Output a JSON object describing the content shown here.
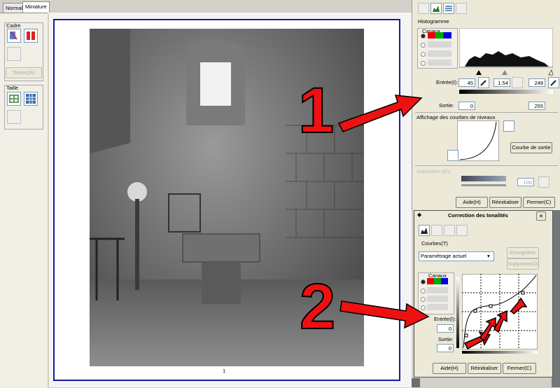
{
  "tabs": [
    {
      "label": "Normal"
    },
    {
      "label": "Miniature"
    }
  ],
  "left_panel": {
    "cadre_title": "Cadre",
    "toutes_label": "Toutes(A)",
    "taille_title": "Taille"
  },
  "preview": {
    "page_number": "1"
  },
  "histogram_panel": {
    "title": "Histogramme",
    "canaux_label": "Canaux",
    "entree_label": "Entrée(I):",
    "entree_black": "45",
    "entree_gamma": "1.54",
    "entree_white": "248",
    "sortie_label": "Sortie:",
    "sortie_black": "0",
    "sortie_white": "255",
    "curve_section_title": "Affichage des courbes de niveaux",
    "courbe_sortie_label": "Courbe de sortie",
    "seuil_label": "Saturation gris",
    "seuil_value": "100",
    "aide_label": "Aide(H)",
    "reinit_label": "Réinitialiser",
    "fermer_label": "Fermer(C)"
  },
  "tone_dialog": {
    "title": "Correction des tonalités",
    "close_label": "✕",
    "courbes_label": "Courbes(T)",
    "preset_value": "Paramétrage actuel",
    "enregistrer_label": "Enregistrer",
    "supprimer_label": "Supprimer(D)",
    "canaux_label": "Canaux",
    "entree_label": "Entrée(I):",
    "entree_value": "0",
    "sortie_label": "Sortie:",
    "sortie_value": "0",
    "aide_label": "Aide(H)",
    "reinit_label": "Réinitialiser",
    "fermer_label": "Fermer(C)"
  },
  "annotations": {
    "one": "1",
    "two": "2"
  },
  "colors": {
    "accent_frame": "#1a1aa0",
    "arrow": "#ee1111",
    "dialog_title": "#1f5cc9"
  }
}
